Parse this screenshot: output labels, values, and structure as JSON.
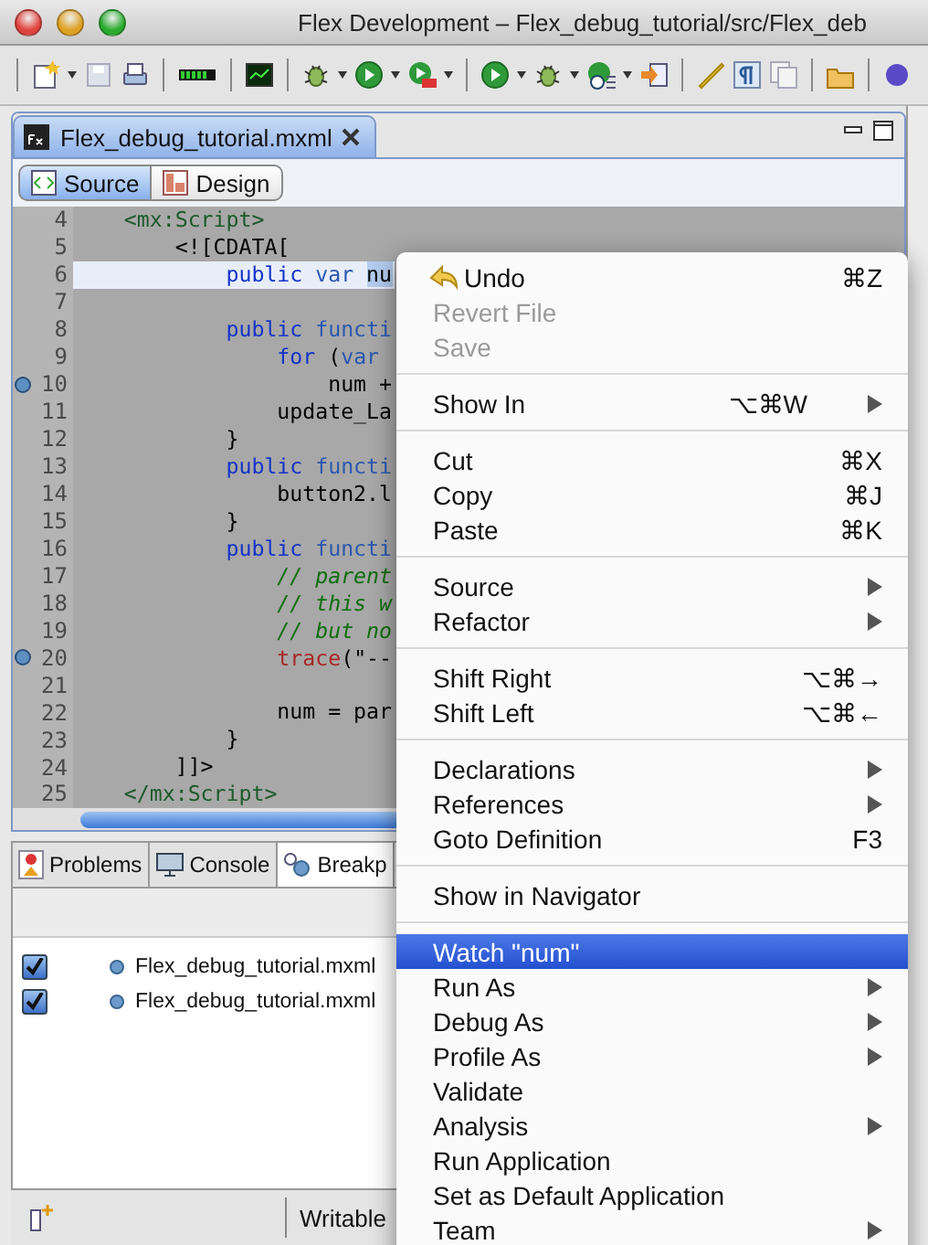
{
  "window": {
    "title": "Flex Development – Flex_debug_tutorial/src/Flex_deb"
  },
  "editor": {
    "tab": {
      "label": "Flex_debug_tutorial.mxml",
      "selected": true
    },
    "modes": [
      {
        "label": "Source",
        "selected": true
      },
      {
        "label": "Design",
        "selected": false
      }
    ],
    "lines": [
      {
        "number": "4",
        "breakpoint": false,
        "current": false,
        "tokens": [
          {
            "kind": "tag",
            "text": "    <mx:Script>"
          }
        ]
      },
      {
        "number": "5",
        "breakpoint": false,
        "current": false,
        "tokens": [
          {
            "kind": "plain",
            "text": "        <![CDATA["
          }
        ]
      },
      {
        "number": "6",
        "breakpoint": false,
        "current": true,
        "tokens": [
          {
            "kind": "keyword",
            "text": "            public"
          },
          {
            "kind": "storage",
            "text": " var "
          },
          {
            "kind": "selected",
            "text": "nu"
          }
        ]
      },
      {
        "number": "7",
        "breakpoint": false,
        "current": false
      },
      {
        "number": "8",
        "breakpoint": false,
        "current": false,
        "tokens": [
          {
            "kind": "keyword",
            "text": "            public"
          },
          {
            "kind": "storage",
            "text": " functi"
          }
        ]
      },
      {
        "number": "9",
        "breakpoint": false,
        "current": false,
        "tokens": [
          {
            "kind": "keyword",
            "text": "                for"
          },
          {
            "kind": "plain",
            "text": " ("
          },
          {
            "kind": "storage",
            "text": "var"
          }
        ]
      },
      {
        "number": "10",
        "breakpoint": true,
        "current": false,
        "tokens": [
          {
            "kind": "plain",
            "text": "                    num +"
          }
        ]
      },
      {
        "number": "11",
        "breakpoint": false,
        "current": false,
        "tokens": [
          {
            "kind": "plain",
            "text": "                update_La"
          }
        ]
      },
      {
        "number": "12",
        "breakpoint": false,
        "current": false,
        "tokens": [
          {
            "kind": "plain",
            "text": "            }"
          }
        ]
      },
      {
        "number": "13",
        "breakpoint": false,
        "current": false,
        "tokens": [
          {
            "kind": "keyword",
            "text": "            public"
          },
          {
            "kind": "storage",
            "text": " functi"
          }
        ]
      },
      {
        "number": "14",
        "breakpoint": false,
        "current": false,
        "tokens": [
          {
            "kind": "plain",
            "text": "                button2.l"
          }
        ]
      },
      {
        "number": "15",
        "breakpoint": false,
        "current": false,
        "tokens": [
          {
            "kind": "plain",
            "text": "            }"
          }
        ]
      },
      {
        "number": "16",
        "breakpoint": false,
        "current": false,
        "tokens": [
          {
            "kind": "keyword",
            "text": "            public"
          },
          {
            "kind": "storage",
            "text": " functi"
          }
        ]
      },
      {
        "number": "17",
        "breakpoint": false,
        "current": false,
        "tokens": [
          {
            "kind": "comment",
            "text": "                // parent"
          }
        ]
      },
      {
        "number": "18",
        "breakpoint": false,
        "current": false,
        "tokens": [
          {
            "kind": "comment",
            "text": "                // this w"
          }
        ]
      },
      {
        "number": "19",
        "breakpoint": false,
        "current": false,
        "tokens": [
          {
            "kind": "comment",
            "text": "                // but no"
          }
        ]
      },
      {
        "number": "20",
        "breakpoint": true,
        "current": false,
        "tokens": [
          {
            "kind": "builtin",
            "text": "                trace"
          },
          {
            "kind": "plain",
            "text": "(\"--"
          }
        ]
      },
      {
        "number": "21",
        "breakpoint": false,
        "current": false
      },
      {
        "number": "22",
        "breakpoint": false,
        "current": false,
        "tokens": [
          {
            "kind": "plain",
            "text": "                num = par"
          }
        ]
      },
      {
        "number": "23",
        "breakpoint": false,
        "current": false,
        "tokens": [
          {
            "kind": "plain",
            "text": "            }"
          }
        ]
      },
      {
        "number": "24",
        "breakpoint": false,
        "current": false,
        "tokens": [
          {
            "kind": "plain",
            "text": "        ]]>"
          }
        ]
      },
      {
        "number": "25",
        "breakpoint": false,
        "current": false,
        "tokens": [
          {
            "kind": "tag",
            "text": "    </mx:Script>"
          }
        ]
      }
    ]
  },
  "bottom_panel": {
    "tabs": [
      {
        "label": "Problems",
        "selected": false
      },
      {
        "label": "Console",
        "selected": false
      },
      {
        "label": "Breakp",
        "selected": true
      }
    ],
    "breakpoints": [
      {
        "file": "Flex_debug_tutorial.mxml",
        "checked": true
      },
      {
        "file": "Flex_debug_tutorial.mxml",
        "checked": true
      }
    ]
  },
  "status_bar": {
    "mode": "Writable"
  },
  "context_menu": {
    "items": [
      {
        "kind": "item",
        "label": "Undo",
        "shortcut": "⌘Z",
        "icon": true,
        "submenu": false,
        "disabled": false,
        "selected": false
      },
      {
        "kind": "item",
        "label": "Revert File",
        "submenu": false,
        "disabled": true,
        "selected": false
      },
      {
        "kind": "item",
        "label": "Save",
        "submenu": false,
        "disabled": true,
        "selected": false
      },
      {
        "kind": "separator"
      },
      {
        "kind": "item",
        "label": "Show In",
        "shortcut": "⌥⌘W",
        "submenu": true,
        "disabled": false,
        "selected": false
      },
      {
        "kind": "separator"
      },
      {
        "kind": "item",
        "label": "Cut",
        "shortcut": "⌘X",
        "submenu": false,
        "disabled": false,
        "selected": false
      },
      {
        "kind": "item",
        "label": "Copy",
        "shortcut": "⌘J",
        "submenu": false,
        "disabled": false,
        "selected": false
      },
      {
        "kind": "item",
        "label": "Paste",
        "shortcut": "⌘K",
        "submenu": false,
        "disabled": false,
        "selected": false
      },
      {
        "kind": "separator"
      },
      {
        "kind": "item",
        "label": "Source",
        "submenu": true,
        "disabled": false,
        "selected": false
      },
      {
        "kind": "item",
        "label": "Refactor",
        "submenu": true,
        "disabled": false,
        "selected": false
      },
      {
        "kind": "separator"
      },
      {
        "kind": "item",
        "label": "Shift Right",
        "shortcut": "⌥⌘→",
        "submenu": false,
        "disabled": false,
        "selected": false
      },
      {
        "kind": "item",
        "label": "Shift Left",
        "shortcut": "⌥⌘←",
        "submenu": false,
        "disabled": false,
        "selected": false
      },
      {
        "kind": "separator"
      },
      {
        "kind": "item",
        "label": "Declarations",
        "submenu": true,
        "disabled": false,
        "selected": false
      },
      {
        "kind": "item",
        "label": "References",
        "submenu": true,
        "disabled": false,
        "selected": false
      },
      {
        "kind": "item",
        "label": "Goto Definition",
        "shortcut": "F3",
        "submenu": false,
        "disabled": false,
        "selected": false
      },
      {
        "kind": "separator"
      },
      {
        "kind": "item",
        "label": "Show in Navigator",
        "submenu": false,
        "disabled": false,
        "selected": false
      },
      {
        "kind": "separator"
      },
      {
        "kind": "item",
        "label": "Watch \"num\"",
        "submenu": false,
        "disabled": false,
        "selected": true
      },
      {
        "kind": "item",
        "label": "Run As",
        "submenu": true,
        "disabled": false,
        "selected": false
      },
      {
        "kind": "item",
        "label": "Debug As",
        "submenu": true,
        "disabled": false,
        "selected": false
      },
      {
        "kind": "item",
        "label": "Profile As",
        "submenu": true,
        "disabled": false,
        "selected": false
      },
      {
        "kind": "item",
        "label": "Validate",
        "submenu": false,
        "disabled": false,
        "selected": false
      },
      {
        "kind": "item",
        "label": "Analysis",
        "submenu": true,
        "disabled": false,
        "selected": false
      },
      {
        "kind": "item",
        "label": "Run Application",
        "submenu": false,
        "disabled": false,
        "selected": false
      },
      {
        "kind": "item",
        "label": "Set as Default Application",
        "submenu": false,
        "disabled": false,
        "selected": false
      },
      {
        "kind": "item",
        "label": "Team",
        "submenu": true,
        "disabled": false,
        "selected": false
      }
    ]
  }
}
